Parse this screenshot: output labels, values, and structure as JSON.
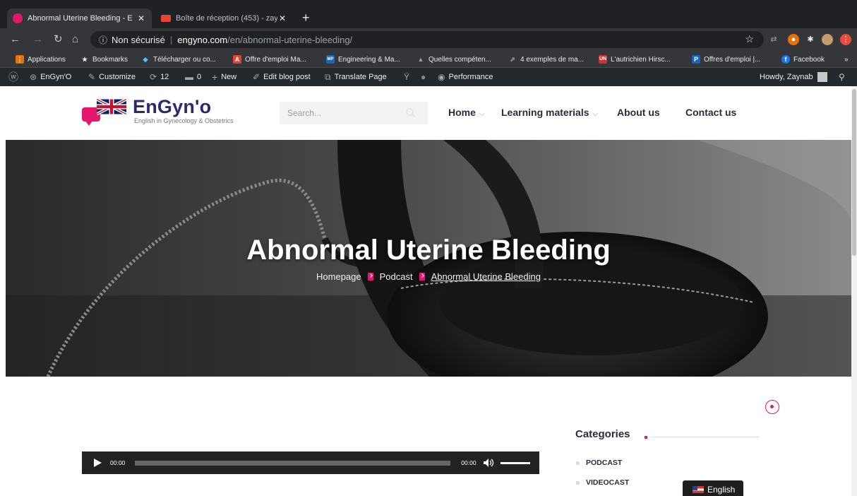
{
  "browser": {
    "tabs": [
      {
        "title": "Abnormal Uterine Bleeding - E",
        "active": true,
        "icon": "engyno-favicon-icon"
      },
      {
        "title": "Boîte de réception (453) - zay",
        "active": false,
        "icon": "gmail-icon"
      }
    ],
    "address": {
      "security": "Non sécurisé",
      "host": "engyno.com",
      "path": "/en/abnormal-uterine-bleeding/"
    },
    "bookmarks": [
      {
        "label": "Applications",
        "icon": "apps-grid-icon",
        "color": "#e8710a"
      },
      {
        "label": "Bookmarks",
        "icon": "star-icon",
        "color": "#e8eaed"
      },
      {
        "label": "Télécharger ou co...",
        "icon": "download-icon",
        "color": "#4fc3f7"
      },
      {
        "label": "Offre d'emploi Ma...",
        "icon": "adobe-icon",
        "color": "#e34234"
      },
      {
        "label": "Engineering & Ma...",
        "icon": "mp-icon",
        "color": "#1e63b5"
      },
      {
        "label": "Quelles compéten...",
        "icon": "mountain-icon",
        "color": "#9aa0a6"
      },
      {
        "label": "4 exemples de ma...",
        "icon": "link-icon",
        "color": "#9aa0a6"
      },
      {
        "label": "L'autrichien Hirsc...",
        "icon": "un-icon",
        "color": "#d32f2f"
      },
      {
        "label": "Offres d'emploi |...",
        "icon": "p-icon",
        "color": "#1565c0"
      },
      {
        "label": "Facebook",
        "icon": "facebook-icon",
        "color": "#1877f2"
      }
    ]
  },
  "wpbar": {
    "site": "EnGyn'O",
    "customize": "Customize",
    "updates": "12",
    "comments": "0",
    "new": "New",
    "edit": "Edit blog post",
    "translate": "Translate Page",
    "performance": "Performance",
    "howdy": "Howdy, Zaynab"
  },
  "header": {
    "logo_name": "EnGyn'o",
    "logo_tagline": "English in Gynecology & Obstetrics",
    "search_placeholder": "Search...",
    "menu": [
      {
        "label": "Home",
        "has_dropdown": true
      },
      {
        "label": "Learning materials",
        "has_dropdown": true
      },
      {
        "label": "About us",
        "has_dropdown": false
      },
      {
        "label": "Contact us",
        "has_dropdown": false
      }
    ]
  },
  "hero": {
    "title": "Abnormal Uterine Bleeding",
    "breadcrumb": [
      "Homepage",
      "Podcast",
      "Abnormal Uterine Bleeding"
    ]
  },
  "sidebar": {
    "categories_title": "Categories",
    "categories": [
      "PODCAST",
      "VIDEOCAST"
    ]
  },
  "player": {
    "current_time": "00:00",
    "duration": "00:00"
  },
  "language_switcher": {
    "label": "English"
  },
  "colors": {
    "accent": "#e5176d",
    "brand_navy": "#2d2a6b",
    "chrome_dark": "#202124",
    "wp_bar": "#23282d"
  }
}
